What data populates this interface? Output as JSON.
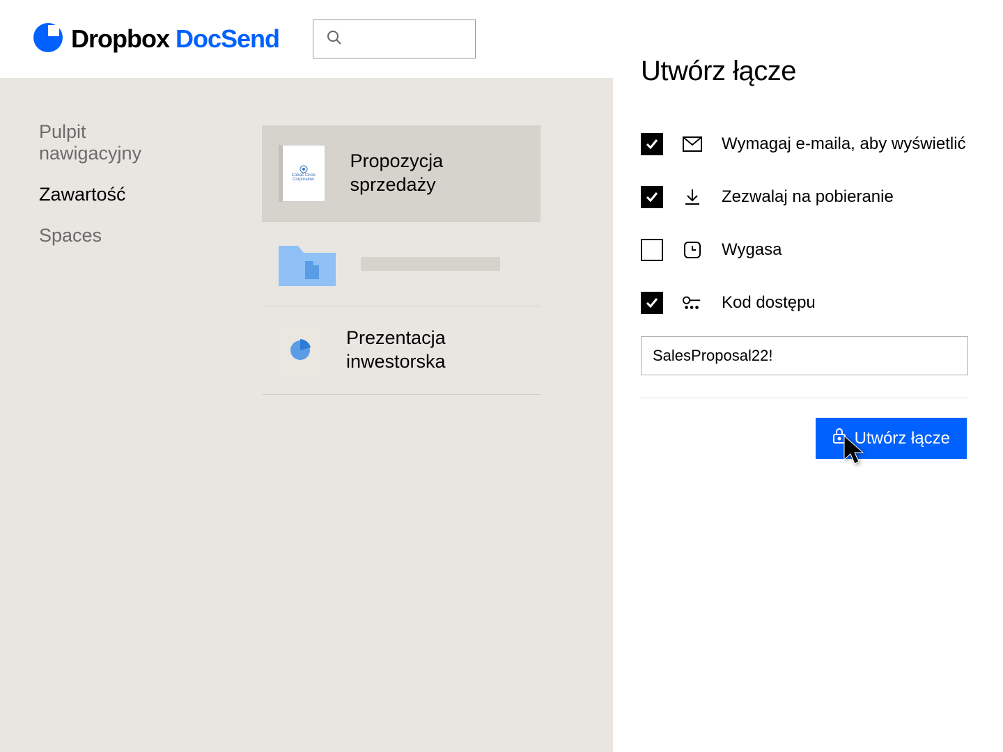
{
  "brand": {
    "part1": "Dropbox ",
    "part2": "DocSend"
  },
  "search": {
    "placeholder": ""
  },
  "sidebar": {
    "items": [
      {
        "label": "Pulpit nawigacyjny",
        "active": false
      },
      {
        "label": "Zawartość",
        "active": true
      },
      {
        "label": "Spaces",
        "active": false
      }
    ]
  },
  "content": {
    "items": [
      {
        "title": "Propozycja sprzedaży",
        "thumb_line1": "Cobalt Circle",
        "thumb_line2": "Corporation"
      },
      {
        "title": ""
      },
      {
        "title": "Prezentacja inwestorska"
      }
    ]
  },
  "panel": {
    "title": "Utwórz łącze",
    "options": [
      {
        "label": "Wymagaj e-maila, aby wyświetlić",
        "checked": true,
        "icon": "mail"
      },
      {
        "label": "Zezwalaj na pobieranie",
        "checked": true,
        "icon": "download"
      },
      {
        "label": "Wygasa",
        "checked": false,
        "icon": "clock"
      },
      {
        "label": "Kod dostępu",
        "checked": true,
        "icon": "key"
      }
    ],
    "passcode": "SalesProposal22!",
    "button": "Utwórz łącze"
  },
  "colors": {
    "accent": "#0061fe"
  }
}
